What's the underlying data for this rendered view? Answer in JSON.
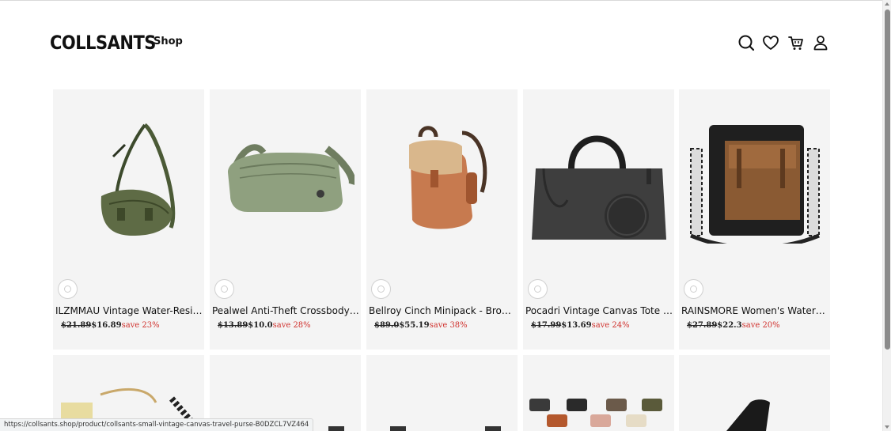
{
  "header": {
    "logo": "COLLSANTS",
    "nav_shop": "Shop",
    "icons": [
      "search-icon",
      "heart-icon",
      "cart-icon",
      "account-icon"
    ]
  },
  "products": [
    {
      "title": "ILZMMAU Vintage Water-Resistant Crossbody Sling Bag",
      "old_price": "$21.89",
      "new_price": "$16.89",
      "save": "save 23%"
    },
    {
      "title": "Pealwel Anti-Theft Crossbody Bag",
      "old_price": "$13.89",
      "new_price": "$10.0",
      "save": "save 28%"
    },
    {
      "title": "Bellroy Cinch Minipack - Bronze",
      "old_price": "$89.0",
      "new_price": "$55.19",
      "save": "save 38%"
    },
    {
      "title": "Pocadri Vintage Canvas Tote Bag",
      "old_price": "$17.99",
      "new_price": "$13.69",
      "save": "save 24%"
    },
    {
      "title": "RAINSMORE Women's Waterproof Crossbody Bag",
      "old_price": "$27.89",
      "new_price": "$22.3",
      "save": "save 20%"
    }
  ],
  "colors": {
    "sale": "#d0312d",
    "card_bg": "#f4f4f4"
  },
  "status_url": "https://collsants.shop/product/collsants-small-vintage-canvas-travel-purse-B0DZCL7VZ464"
}
